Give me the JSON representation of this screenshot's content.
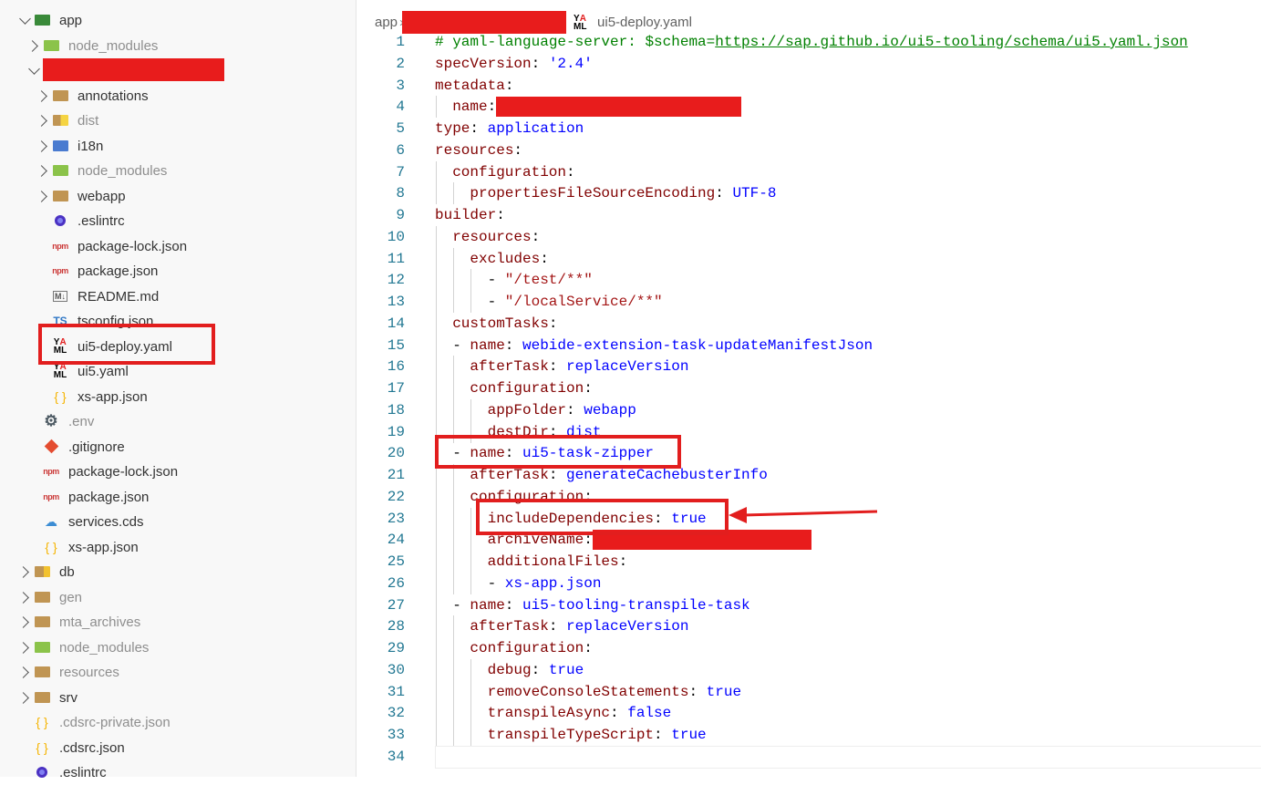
{
  "sidebar": {
    "items": [
      {
        "label": "app",
        "depth": 0,
        "kind": "folder-open",
        "icon": "app-folder-icon",
        "dim": false
      },
      {
        "label": "node_modules",
        "depth": 1,
        "kind": "folder",
        "icon": "node-folder-icon",
        "dim": true
      },
      {
        "label": "",
        "depth": 1,
        "kind": "folder-open",
        "icon": "",
        "dim": false,
        "redacted": true
      },
      {
        "label": "annotations",
        "depth": 2,
        "kind": "folder",
        "icon": "folder-icon",
        "dim": false
      },
      {
        "label": "dist",
        "depth": 2,
        "kind": "folder",
        "icon": "dist-folder-icon",
        "dim": true
      },
      {
        "label": "i18n",
        "depth": 2,
        "kind": "folder",
        "icon": "i18n-folder-icon",
        "dim": false
      },
      {
        "label": "node_modules",
        "depth": 2,
        "kind": "folder",
        "icon": "node-folder-icon",
        "dim": true
      },
      {
        "label": "webapp",
        "depth": 2,
        "kind": "folder",
        "icon": "folder-icon",
        "dim": false
      },
      {
        "label": ".eslintrc",
        "depth": 2,
        "kind": "file",
        "icon": "eslint-icon",
        "dim": false
      },
      {
        "label": "package-lock.json",
        "depth": 2,
        "kind": "file",
        "icon": "npm-icon",
        "dim": false
      },
      {
        "label": "package.json",
        "depth": 2,
        "kind": "file",
        "icon": "npm-icon",
        "dim": false
      },
      {
        "label": "README.md",
        "depth": 2,
        "kind": "file",
        "icon": "markdown-icon",
        "dim": false
      },
      {
        "label": "tsconfig.json",
        "depth": 2,
        "kind": "file",
        "icon": "typescript-icon",
        "dim": false
      },
      {
        "label": "ui5-deploy.yaml",
        "depth": 2,
        "kind": "file",
        "icon": "yaml-icon",
        "dim": false
      },
      {
        "label": "ui5.yaml",
        "depth": 2,
        "kind": "file",
        "icon": "yaml-icon",
        "dim": false
      },
      {
        "label": "xs-app.json",
        "depth": 2,
        "kind": "file",
        "icon": "json-icon",
        "dim": false
      },
      {
        "label": ".env",
        "depth": 1,
        "kind": "file",
        "icon": "gear-icon",
        "dim": true
      },
      {
        "label": ".gitignore",
        "depth": 1,
        "kind": "file",
        "icon": "git-icon",
        "dim": false
      },
      {
        "label": "package-lock.json",
        "depth": 1,
        "kind": "file",
        "icon": "npm-icon",
        "dim": false
      },
      {
        "label": "package.json",
        "depth": 1,
        "kind": "file",
        "icon": "npm-icon",
        "dim": false
      },
      {
        "label": "services.cds",
        "depth": 1,
        "kind": "file",
        "icon": "cds-icon",
        "dim": false
      },
      {
        "label": "xs-app.json",
        "depth": 1,
        "kind": "file",
        "icon": "json-icon",
        "dim": false
      },
      {
        "label": "db",
        "depth": 0,
        "kind": "folder",
        "icon": "db-folder-icon",
        "dim": false
      },
      {
        "label": "gen",
        "depth": 0,
        "kind": "folder",
        "icon": "folder-icon",
        "dim": true
      },
      {
        "label": "mta_archives",
        "depth": 0,
        "kind": "folder",
        "icon": "folder-icon",
        "dim": true
      },
      {
        "label": "node_modules",
        "depth": 0,
        "kind": "folder",
        "icon": "node-folder-icon",
        "dim": true
      },
      {
        "label": "resources",
        "depth": 0,
        "kind": "folder",
        "icon": "folder-icon",
        "dim": true
      },
      {
        "label": "srv",
        "depth": 0,
        "kind": "folder",
        "icon": "folder-icon",
        "dim": false
      },
      {
        "label": ".cdsrc-private.json",
        "depth": 0,
        "kind": "file",
        "icon": "json-icon",
        "dim": true
      },
      {
        "label": ".cdsrc.json",
        "depth": 0,
        "kind": "file",
        "icon": "json-icon",
        "dim": false
      },
      {
        "label": ".eslintrc",
        "depth": 0,
        "kind": "file",
        "icon": "eslint-icon",
        "dim": false
      }
    ]
  },
  "breadcrumb": {
    "root": "app",
    "file": "ui5-deploy.yaml"
  },
  "annotation_color": "#e21e1e",
  "editor": {
    "lines": [
      {
        "i": 0,
        "t": [
          [
            "c",
            "# yaml-language-server: $schema="
          ],
          [
            "u",
            "https://sap.github.io/ui5-tooling/schema/ui5.yaml.json"
          ]
        ]
      },
      {
        "i": 0,
        "t": [
          [
            "k",
            "specVersion"
          ],
          [
            "p",
            ": "
          ],
          [
            "v",
            "'2.4'"
          ]
        ]
      },
      {
        "i": 0,
        "t": [
          [
            "k",
            "metadata"
          ],
          [
            "p",
            ":"
          ]
        ]
      },
      {
        "i": 1,
        "t": [
          [
            "k",
            "name"
          ],
          [
            "p",
            ":"
          ],
          [
            "r",
            "28"
          ]
        ]
      },
      {
        "i": 0,
        "t": [
          [
            "k",
            "type"
          ],
          [
            "p",
            ": "
          ],
          [
            "v",
            "application"
          ]
        ]
      },
      {
        "i": 0,
        "t": [
          [
            "k",
            "resources"
          ],
          [
            "p",
            ":"
          ]
        ]
      },
      {
        "i": 1,
        "t": [
          [
            "k",
            "configuration"
          ],
          [
            "p",
            ":"
          ]
        ]
      },
      {
        "i": 2,
        "t": [
          [
            "k",
            "propertiesFileSourceEncoding"
          ],
          [
            "p",
            ": "
          ],
          [
            "v",
            "UTF-8"
          ]
        ]
      },
      {
        "i": 0,
        "t": [
          [
            "k",
            "builder"
          ],
          [
            "p",
            ":"
          ]
        ]
      },
      {
        "i": 1,
        "t": [
          [
            "k",
            "resources"
          ],
          [
            "p",
            ":"
          ]
        ]
      },
      {
        "i": 2,
        "t": [
          [
            "k",
            "excludes"
          ],
          [
            "p",
            ":"
          ]
        ]
      },
      {
        "i": 3,
        "t": [
          [
            "p",
            "- "
          ],
          [
            "s",
            "\"/test/**\""
          ]
        ]
      },
      {
        "i": 3,
        "t": [
          [
            "p",
            "- "
          ],
          [
            "s",
            "\"/localService/**\""
          ]
        ]
      },
      {
        "i": 1,
        "t": [
          [
            "k",
            "customTasks"
          ],
          [
            "p",
            ":"
          ]
        ]
      },
      {
        "i": 1,
        "t": [
          [
            "p",
            "- "
          ],
          [
            "k",
            "name"
          ],
          [
            "p",
            ": "
          ],
          [
            "v",
            "webide-extension-task-updateManifestJson"
          ]
        ]
      },
      {
        "i": 2,
        "t": [
          [
            "k",
            "afterTask"
          ],
          [
            "p",
            ": "
          ],
          [
            "v",
            "replaceVersion"
          ]
        ]
      },
      {
        "i": 2,
        "t": [
          [
            "k",
            "configuration"
          ],
          [
            "p",
            ":"
          ]
        ]
      },
      {
        "i": 3,
        "t": [
          [
            "k",
            "appFolder"
          ],
          [
            "p",
            ": "
          ],
          [
            "v",
            "webapp"
          ]
        ]
      },
      {
        "i": 3,
        "t": [
          [
            "k",
            "destDir"
          ],
          [
            "p",
            ": "
          ],
          [
            "v",
            "dist"
          ]
        ]
      },
      {
        "i": 1,
        "t": [
          [
            "p",
            "- "
          ],
          [
            "k",
            "name"
          ],
          [
            "p",
            ": "
          ],
          [
            "v",
            "ui5-task-zipper"
          ]
        ]
      },
      {
        "i": 2,
        "t": [
          [
            "k",
            "afterTask"
          ],
          [
            "p",
            ": "
          ],
          [
            "v",
            "generateCachebusterInfo"
          ]
        ]
      },
      {
        "i": 2,
        "t": [
          [
            "k",
            "configuration"
          ],
          [
            "p",
            ":"
          ]
        ]
      },
      {
        "i": 3,
        "t": [
          [
            "k",
            "includeDependencies"
          ],
          [
            "p",
            ": "
          ],
          [
            "v",
            "true"
          ]
        ]
      },
      {
        "i": 3,
        "t": [
          [
            "k",
            "archiveName"
          ],
          [
            "p",
            ":"
          ],
          [
            "r",
            "25"
          ]
        ]
      },
      {
        "i": 3,
        "t": [
          [
            "k",
            "additionalFiles"
          ],
          [
            "p",
            ":"
          ]
        ]
      },
      {
        "i": 3,
        "t": [
          [
            "p",
            "- "
          ],
          [
            "v",
            "xs-app.json"
          ]
        ]
      },
      {
        "i": 1,
        "t": [
          [
            "p",
            "- "
          ],
          [
            "k",
            "name"
          ],
          [
            "p",
            ": "
          ],
          [
            "v",
            "ui5-tooling-transpile-task"
          ]
        ]
      },
      {
        "i": 2,
        "t": [
          [
            "k",
            "afterTask"
          ],
          [
            "p",
            ": "
          ],
          [
            "v",
            "replaceVersion"
          ]
        ]
      },
      {
        "i": 2,
        "t": [
          [
            "k",
            "configuration"
          ],
          [
            "p",
            ":"
          ]
        ]
      },
      {
        "i": 3,
        "t": [
          [
            "k",
            "debug"
          ],
          [
            "p",
            ": "
          ],
          [
            "v",
            "true"
          ]
        ]
      },
      {
        "i": 3,
        "t": [
          [
            "k",
            "removeConsoleStatements"
          ],
          [
            "p",
            ": "
          ],
          [
            "v",
            "true"
          ]
        ]
      },
      {
        "i": 3,
        "t": [
          [
            "k",
            "transpileAsync"
          ],
          [
            "p",
            ": "
          ],
          [
            "v",
            "false"
          ]
        ]
      },
      {
        "i": 3,
        "t": [
          [
            "k",
            "transpileTypeScript"
          ],
          [
            "p",
            ": "
          ],
          [
            "v",
            "true"
          ]
        ]
      },
      {
        "i": 0,
        "t": []
      }
    ]
  }
}
